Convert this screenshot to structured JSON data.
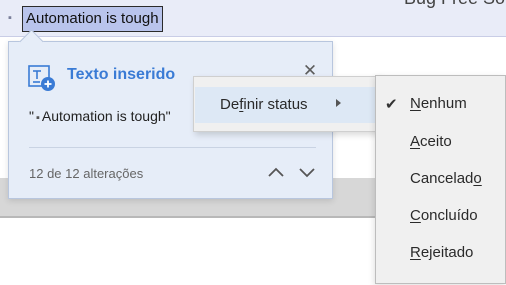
{
  "document": {
    "selected_text": "Automation is tough",
    "cut_title": "Bug Free So"
  },
  "change_card": {
    "title": "Texto inserido",
    "quote_prefix": "\"",
    "quote_text": "Automation is tough",
    "quote_suffix": "\"",
    "counter": "12 de 12 alterações",
    "icons": [
      "insert-text-icon",
      "close-icon",
      "chevron-up-icon",
      "chevron-down-icon"
    ]
  },
  "context_menu": {
    "item": {
      "before": "De",
      "mnemonic": "f",
      "after": "inir status"
    }
  },
  "status_submenu": {
    "items": [
      {
        "before": "",
        "mnemonic": "N",
        "after": "enhum",
        "checked": true
      },
      {
        "before": "",
        "mnemonic": "A",
        "after": "ceito",
        "checked": false
      },
      {
        "before": "Cancelad",
        "mnemonic": "o",
        "after": "",
        "checked": false
      },
      {
        "before": "",
        "mnemonic": "C",
        "after": "oncluído",
        "checked": false
      },
      {
        "before": "",
        "mnemonic": "R",
        "after": "ejeitado",
        "checked": false
      }
    ],
    "check_glyph": "✔"
  },
  "colors": {
    "accent": "#3a7bd5",
    "card_bg": "#e6edf8",
    "menu_bg": "#f0f0f0",
    "selection_bg": "#b9c4ec"
  }
}
